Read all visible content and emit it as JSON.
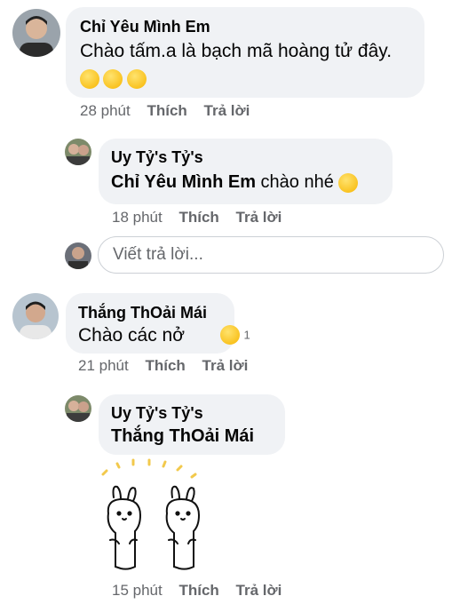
{
  "comments": [
    {
      "author": "Chỉ Yêu Mình Em",
      "text": "Chào tấm.a là bạch mã hoàng tử đây.",
      "time": "28 phút",
      "like": "Thích",
      "reply": "Trả lời"
    },
    {
      "author": "Uy Tỷ's Tỷ's",
      "mention": "Chỉ Yêu Mình Em",
      "text": "chào nhé",
      "time": "18 phút",
      "like": "Thích",
      "reply": "Trả lời"
    },
    {
      "author": "Thắng ThOải Mái",
      "text": "Chào các nở",
      "reaction_count": "1",
      "time": "21 phút",
      "like": "Thích",
      "reply": "Trả lời"
    },
    {
      "author": "Uy Tỷ's Tỷ's",
      "mention": "Thắng ThOải Mái",
      "sticker": "two-bunnies-sticker",
      "time": "15 phút",
      "like": "Thích",
      "reply": "Trả lời"
    }
  ],
  "reply_box": {
    "placeholder": "Viết trả lời..."
  },
  "colors": {
    "bubble": "#f0f2f5",
    "meta": "#65676b",
    "text": "#050505"
  }
}
